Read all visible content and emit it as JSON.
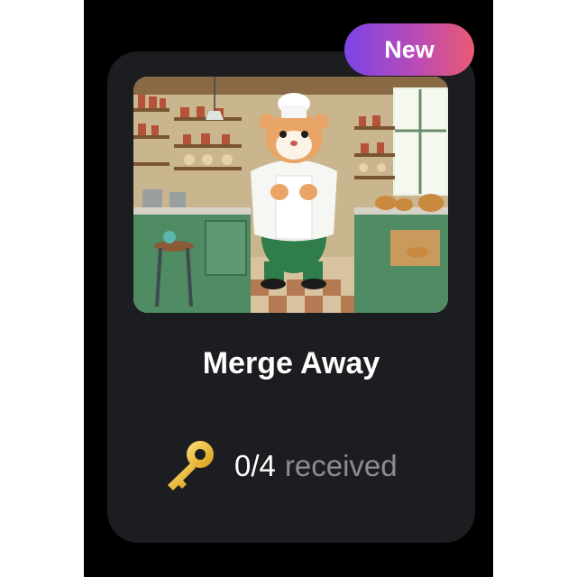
{
  "badge": {
    "label": "New"
  },
  "card": {
    "image_icon": "hamster-chef-kitchen-illustration",
    "title": "Merge Away",
    "progress_icon": "key-icon",
    "progress_count": "0/4",
    "progress_suffix": "received"
  },
  "colors": {
    "card_background": "#1c1d20",
    "badge_gradient_start": "#7b45e6",
    "badge_gradient_end": "#e85a74",
    "secondary_text": "#8b8d93"
  }
}
